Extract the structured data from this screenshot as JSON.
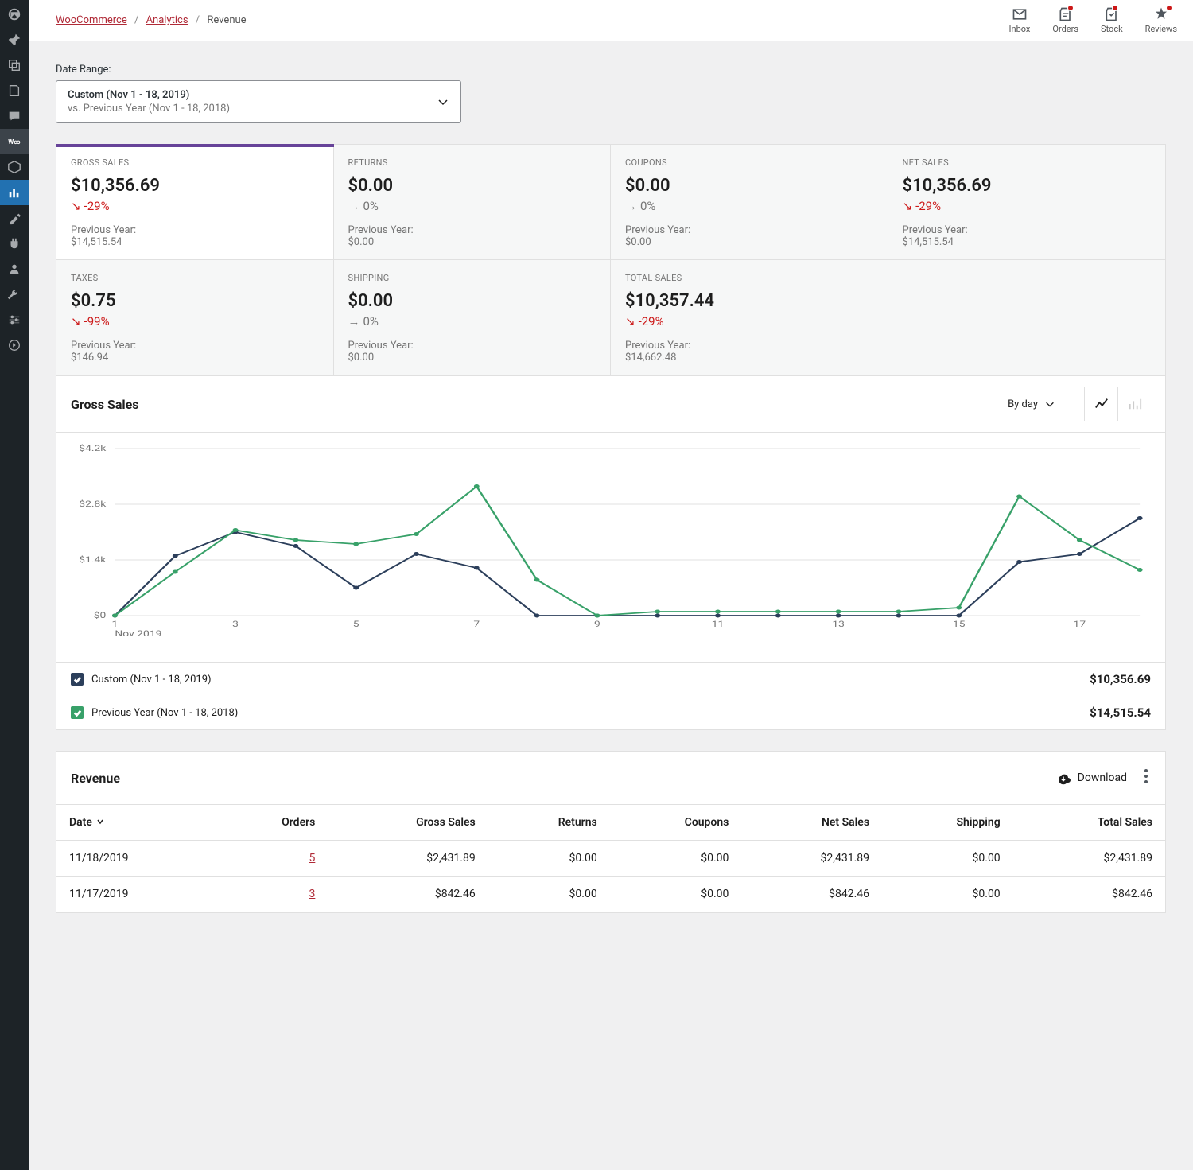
{
  "breadcrumb": {
    "root": "WooCommerce",
    "section": "Analytics",
    "current": "Revenue"
  },
  "topbar": {
    "inbox": "Inbox",
    "orders": "Orders",
    "stock": "Stock",
    "reviews": "Reviews"
  },
  "dateRange": {
    "label": "Date Range:",
    "main": "Custom (Nov 1 - 18, 2019)",
    "sub": "vs. Previous Year (Nov 1 - 18, 2018)"
  },
  "summary": [
    {
      "label": "GROSS SALES",
      "value": "$10,356.69",
      "delta": "-29%",
      "dir": "down",
      "prevLabel": "Previous Year:",
      "prevValue": "$14,515.54",
      "active": true
    },
    {
      "label": "RETURNS",
      "value": "$0.00",
      "delta": "0%",
      "dir": "neutral",
      "prevLabel": "Previous Year:",
      "prevValue": "$0.00"
    },
    {
      "label": "COUPONS",
      "value": "$0.00",
      "delta": "0%",
      "dir": "neutral",
      "prevLabel": "Previous Year:",
      "prevValue": "$0.00"
    },
    {
      "label": "NET SALES",
      "value": "$10,356.69",
      "delta": "-29%",
      "dir": "down",
      "prevLabel": "Previous Year:",
      "prevValue": "$14,515.54"
    },
    {
      "label": "TAXES",
      "value": "$0.75",
      "delta": "-99%",
      "dir": "down",
      "prevLabel": "Previous Year:",
      "prevValue": "$146.94"
    },
    {
      "label": "SHIPPING",
      "value": "$0.00",
      "delta": "0%",
      "dir": "neutral",
      "prevLabel": "Previous Year:",
      "prevValue": "$0.00"
    },
    {
      "label": "TOTAL SALES",
      "value": "$10,357.44",
      "delta": "-29%",
      "dir": "down",
      "prevLabel": "Previous Year:",
      "prevValue": "$14,662.48"
    }
  ],
  "chart": {
    "title": "Gross Sales",
    "interval": "By day",
    "legend": [
      {
        "label": "Custom (Nov 1 - 18, 2019)",
        "total": "$10,356.69",
        "color": "#2c3f5b"
      },
      {
        "label": "Previous Year (Nov 1 - 18, 2018)",
        "total": "$14,515.54",
        "color": "#38a169"
      }
    ],
    "yTicks": [
      "$4.2k",
      "$2.8k",
      "$1.4k",
      "$0"
    ],
    "xTicks": [
      "1",
      "3",
      "5",
      "7",
      "9",
      "11",
      "13",
      "15",
      "17"
    ],
    "xMonth": "Nov 2019"
  },
  "chart_data": {
    "type": "line",
    "title": "Gross Sales",
    "xlabel": "Nov 2019",
    "ylabel": "",
    "ylim": [
      0,
      4200
    ],
    "x": [
      1,
      2,
      3,
      4,
      5,
      6,
      7,
      8,
      9,
      10,
      11,
      12,
      13,
      14,
      15,
      16,
      17,
      18
    ],
    "series": [
      {
        "name": "Custom (Nov 1 - 18, 2019)",
        "color": "#2c3f5b",
        "values": [
          0,
          1500,
          2100,
          1750,
          700,
          1550,
          1200,
          0,
          0,
          0,
          0,
          0,
          0,
          0,
          0,
          1350,
          1550,
          2450
        ]
      },
      {
        "name": "Previous Year (Nov 1 - 18, 2018)",
        "color": "#38a169",
        "values": [
          0,
          1100,
          2150,
          1900,
          1800,
          2050,
          3250,
          900,
          0,
          100,
          100,
          100,
          100,
          100,
          200,
          3000,
          1900,
          1150
        ]
      }
    ]
  },
  "table": {
    "title": "Revenue",
    "download": "Download",
    "columns": [
      "Date",
      "Orders",
      "Gross Sales",
      "Returns",
      "Coupons",
      "Net Sales",
      "Shipping",
      "Total Sales"
    ],
    "rows": [
      {
        "date": "11/18/2019",
        "orders": "5",
        "gross": "$2,431.89",
        "returns": "$0.00",
        "coupons": "$0.00",
        "net": "$2,431.89",
        "shipping": "$0.00",
        "total": "$2,431.89"
      },
      {
        "date": "11/17/2019",
        "orders": "3",
        "gross": "$842.46",
        "returns": "$0.00",
        "coupons": "$0.00",
        "net": "$842.46",
        "shipping": "$0.00",
        "total": "$842.46"
      }
    ]
  }
}
